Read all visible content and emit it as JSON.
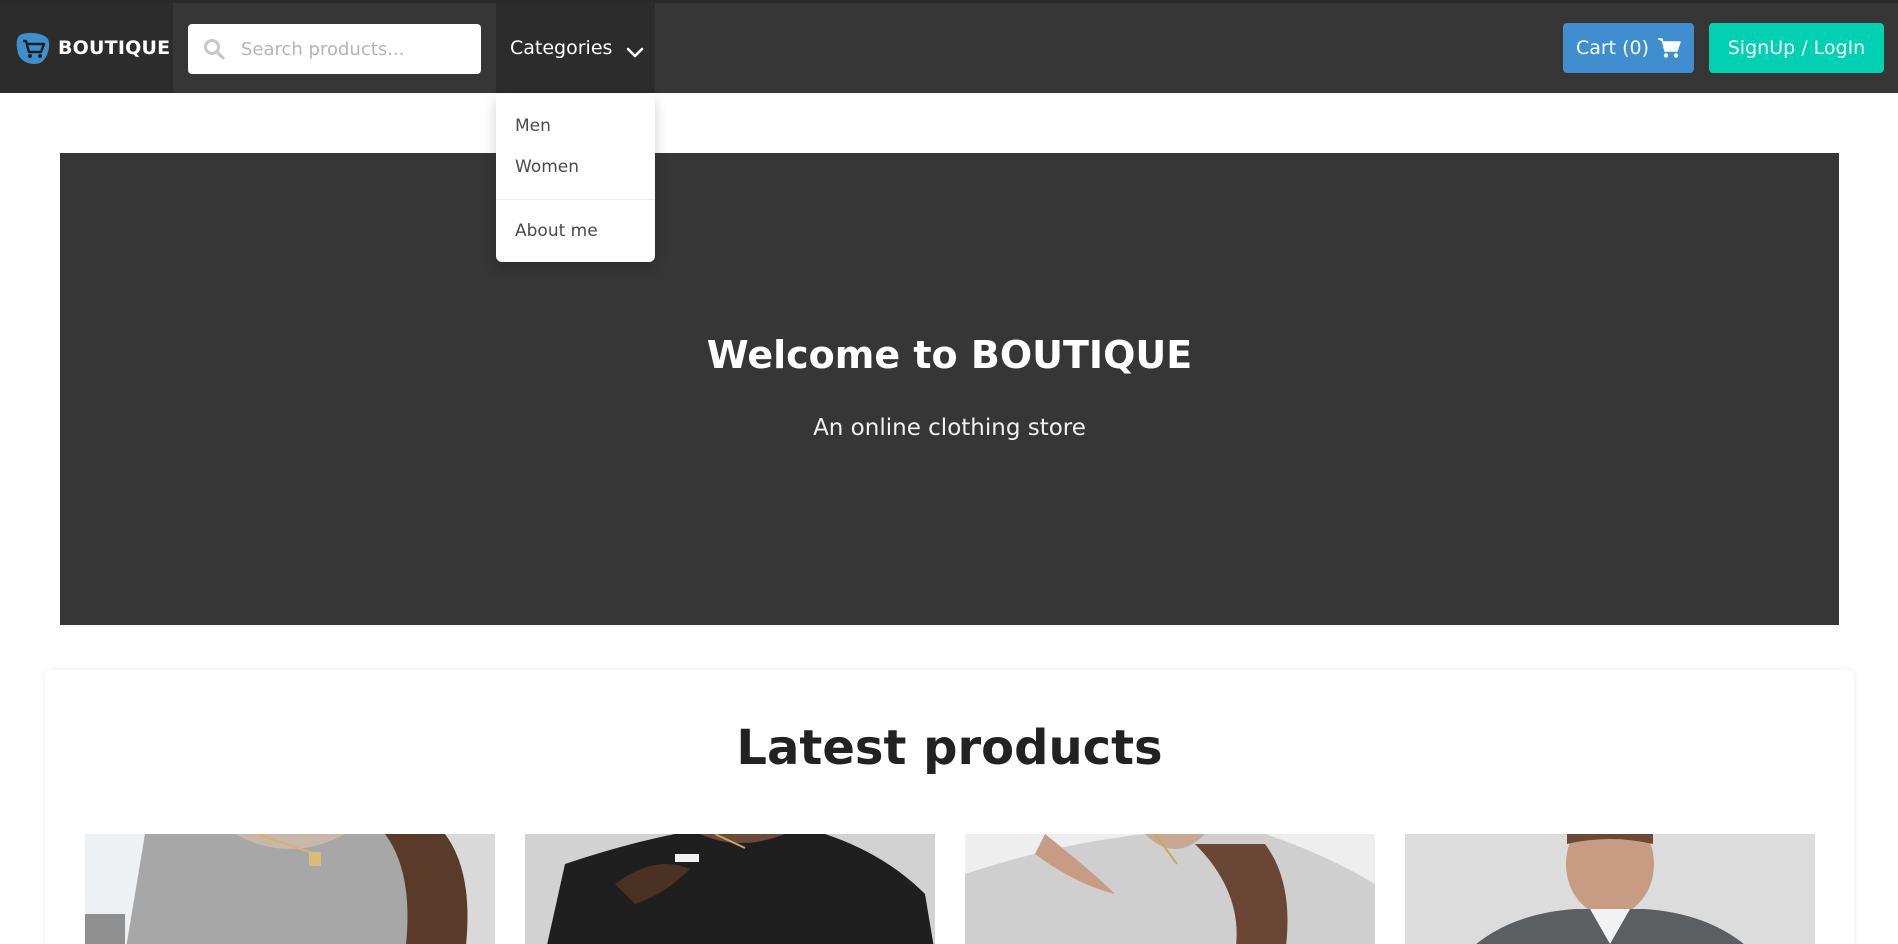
{
  "brand": {
    "name": "BOUTIQUE",
    "logo_icon": "shopping-cart-logo-icon"
  },
  "search": {
    "placeholder": "Search products...",
    "value": ""
  },
  "nav": {
    "categories_label": "Categories",
    "cart_label": "Cart (0)",
    "signup_label": "SignUp / LogIn"
  },
  "dropdown": {
    "items": [
      {
        "label": "Men"
      },
      {
        "label": "Women"
      },
      {
        "label": "About me"
      }
    ]
  },
  "hero": {
    "title": "Welcome to BOUTIQUE",
    "subtitle": "An online clothing store"
  },
  "latest": {
    "title": "Latest products",
    "products": [
      {
        "image": "gray ribbed sweater with pendant necklace"
      },
      {
        "image": "black knit sweater with necklace"
      },
      {
        "image": "white cable knit sweater with necklace"
      },
      {
        "image": "man in gray quarter-zip sweater"
      }
    ]
  },
  "colors": {
    "navbar": "#363636",
    "cart_button": "#3e8ed0",
    "signup_button": "#00d1b2",
    "hero": "#363636"
  }
}
